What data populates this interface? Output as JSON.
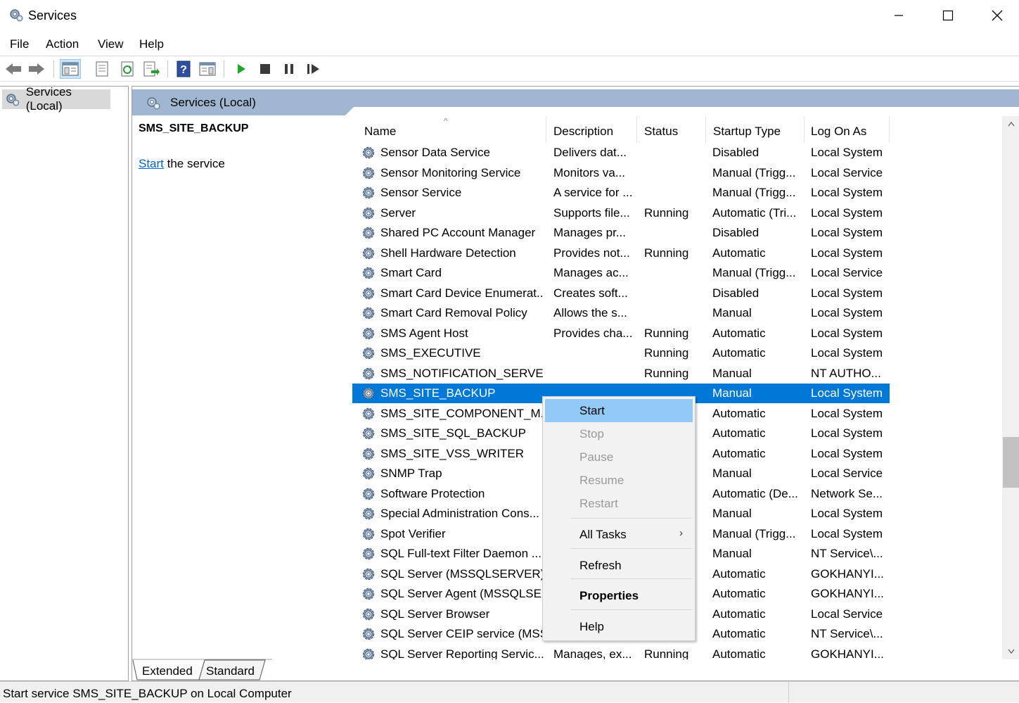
{
  "window": {
    "title": "Services"
  },
  "menu": [
    "File",
    "Action",
    "View",
    "Help"
  ],
  "tree": {
    "item": "Services (Local)"
  },
  "pane": {
    "header": "Services (Local)",
    "selected_service": "SMS_SITE_BACKUP",
    "action_link": "Start",
    "action_suffix": " the service"
  },
  "table": {
    "columns": [
      "Name",
      "Description",
      "Status",
      "Startup Type",
      "Log On As"
    ],
    "rows": [
      {
        "name": "Sensor Data Service",
        "desc": "Delivers dat...",
        "status": "",
        "startup": "Disabled",
        "logon": "Local System"
      },
      {
        "name": "Sensor Monitoring Service",
        "desc": "Monitors va...",
        "status": "",
        "startup": "Manual (Trigg...",
        "logon": "Local Service"
      },
      {
        "name": "Sensor Service",
        "desc": "A service for ...",
        "status": "",
        "startup": "Manual (Trigg...",
        "logon": "Local System"
      },
      {
        "name": "Server",
        "desc": "Supports file...",
        "status": "Running",
        "startup": "Automatic (Tri...",
        "logon": "Local System"
      },
      {
        "name": "Shared PC Account Manager",
        "desc": "Manages pr...",
        "status": "",
        "startup": "Disabled",
        "logon": "Local System"
      },
      {
        "name": "Shell Hardware Detection",
        "desc": "Provides not...",
        "status": "Running",
        "startup": "Automatic",
        "logon": "Local System"
      },
      {
        "name": "Smart Card",
        "desc": "Manages ac...",
        "status": "",
        "startup": "Manual (Trigg...",
        "logon": "Local Service"
      },
      {
        "name": "Smart Card Device Enumerat...",
        "desc": "Creates soft...",
        "status": "",
        "startup": "Disabled",
        "logon": "Local System"
      },
      {
        "name": "Smart Card Removal Policy",
        "desc": "Allows the s...",
        "status": "",
        "startup": "Manual",
        "logon": "Local System"
      },
      {
        "name": "SMS Agent Host",
        "desc": "Provides cha...",
        "status": "Running",
        "startup": "Automatic",
        "logon": "Local System"
      },
      {
        "name": "SMS_EXECUTIVE",
        "desc": "",
        "status": "Running",
        "startup": "Automatic",
        "logon": "Local System"
      },
      {
        "name": "SMS_NOTIFICATION_SERVER",
        "desc": "",
        "status": "Running",
        "startup": "Manual",
        "logon": "NT AUTHO..."
      },
      {
        "name": "SMS_SITE_BACKUP",
        "desc": "",
        "status": "",
        "startup": "Manual",
        "logon": "Local System",
        "selected": true
      },
      {
        "name": "SMS_SITE_COMPONENT_M...",
        "desc": "",
        "status": "",
        "startup": "Automatic",
        "logon": "Local System"
      },
      {
        "name": "SMS_SITE_SQL_BACKUP",
        "desc": "",
        "status": "",
        "startup": "Automatic",
        "logon": "Local System"
      },
      {
        "name": "SMS_SITE_VSS_WRITER",
        "desc": "",
        "status": "",
        "startup": "Automatic",
        "logon": "Local System"
      },
      {
        "name": "SNMP Trap",
        "desc": "",
        "status": "",
        "startup": "Manual",
        "logon": "Local Service"
      },
      {
        "name": "Software Protection",
        "desc": "",
        "status": "",
        "startup": "Automatic (De...",
        "logon": "Network Se..."
      },
      {
        "name": "Special Administration Cons...",
        "desc": "",
        "status": "",
        "startup": "Manual",
        "logon": "Local System"
      },
      {
        "name": "Spot Verifier",
        "desc": "",
        "status": "",
        "startup": "Manual (Trigg...",
        "logon": "Local System"
      },
      {
        "name": "SQL Full-text Filter Daemon ...",
        "desc": "",
        "status": "",
        "startup": "Manual",
        "logon": "NT Service\\..."
      },
      {
        "name": "SQL Server (MSSQLSERVER)",
        "desc": "",
        "status": "",
        "startup": "Automatic",
        "logon": "GOKHANYI..."
      },
      {
        "name": "SQL Server Agent (MSSQLSE...",
        "desc": "",
        "status": "",
        "startup": "Automatic",
        "logon": "GOKHANYI..."
      },
      {
        "name": "SQL Server Browser",
        "desc": "",
        "status": "",
        "startup": "Automatic",
        "logon": "Local Service"
      },
      {
        "name": "SQL Server CEIP service (MSS...",
        "desc": "",
        "status": "",
        "startup": "Automatic",
        "logon": "NT Service\\..."
      },
      {
        "name": "SQL Server Reporting Servic...",
        "desc": "Manages, ex...",
        "status": "Running",
        "startup": "Automatic",
        "logon": "GOKHANYI..."
      }
    ]
  },
  "context_menu": {
    "items": [
      {
        "label": "Start",
        "state": "hover"
      },
      {
        "label": "Stop",
        "state": "disabled"
      },
      {
        "label": "Pause",
        "state": "disabled"
      },
      {
        "label": "Resume",
        "state": "disabled"
      },
      {
        "label": "Restart",
        "state": "disabled"
      },
      {
        "label": "All Tasks",
        "state": "submenu"
      },
      {
        "label": "Refresh",
        "state": "normal"
      },
      {
        "label": "Properties",
        "state": "bold"
      },
      {
        "label": "Help",
        "state": "normal"
      }
    ]
  },
  "tabs": [
    "Extended",
    "Standard"
  ],
  "status": "Start service SMS_SITE_BACKUP on Local Computer",
  "icons": {
    "back": "arrow-left-icon",
    "forward": "arrow-right-icon",
    "play": "play-icon",
    "stop": "stop-icon",
    "pause": "pause-icon",
    "resume": "resume-icon"
  },
  "colors": {
    "selection": "#0078d7",
    "header_band": "#9fb7d1",
    "menu_hover": "#91c9f7",
    "play": "#1fa82b"
  }
}
